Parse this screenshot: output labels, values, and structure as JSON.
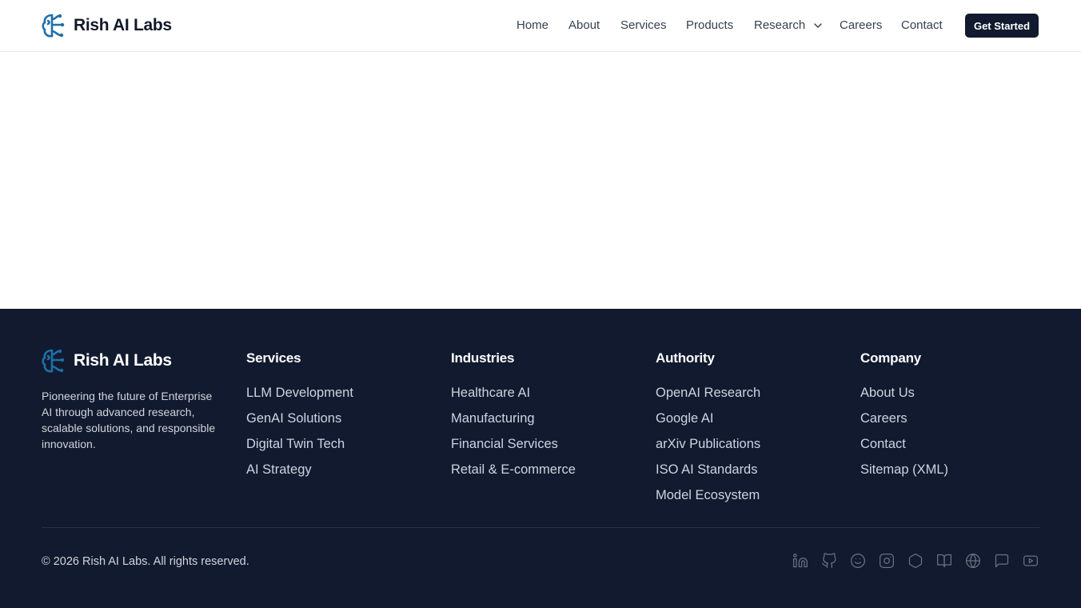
{
  "brand": {
    "name": "Rish AI Labs"
  },
  "nav": {
    "items": [
      {
        "label": "Home"
      },
      {
        "label": "About"
      },
      {
        "label": "Services"
      },
      {
        "label": "Products"
      },
      {
        "label": "Research",
        "has_dropdown": true
      },
      {
        "label": "Careers"
      },
      {
        "label": "Contact"
      }
    ],
    "cta_label": "Get Started"
  },
  "footer": {
    "tagline": "Pioneering the future of Enterprise AI through advanced research, scalable solutions, and responsible innovation.",
    "columns": [
      {
        "title": "Services",
        "links": [
          "LLM Development",
          "GenAI Solutions",
          "Digital Twin Tech",
          "AI Strategy"
        ]
      },
      {
        "title": "Industries",
        "links": [
          "Healthcare AI",
          "Manufacturing",
          "Financial Services",
          "Retail & E-commerce"
        ]
      },
      {
        "title": "Authority",
        "links": [
          "OpenAI Research",
          "Google AI",
          "arXiv Publications",
          "ISO AI Standards",
          "Model Ecosystem"
        ]
      },
      {
        "title": "Company",
        "links": [
          "About Us",
          "Careers",
          "Contact",
          "Sitemap (XML)"
        ]
      }
    ],
    "copyright": "© 2026 Rish AI Labs. All rights reserved.",
    "social_icons": [
      "linkedin-icon",
      "github-icon",
      "smile-icon",
      "instagram-icon",
      "hexagon-icon",
      "book-icon",
      "globe-icon",
      "chat-icon",
      "youtube-icon"
    ]
  },
  "colors": {
    "footer_bg": "#111a2e",
    "accent_logo": "#1e6fa8",
    "cta_bg": "#111a2e"
  }
}
